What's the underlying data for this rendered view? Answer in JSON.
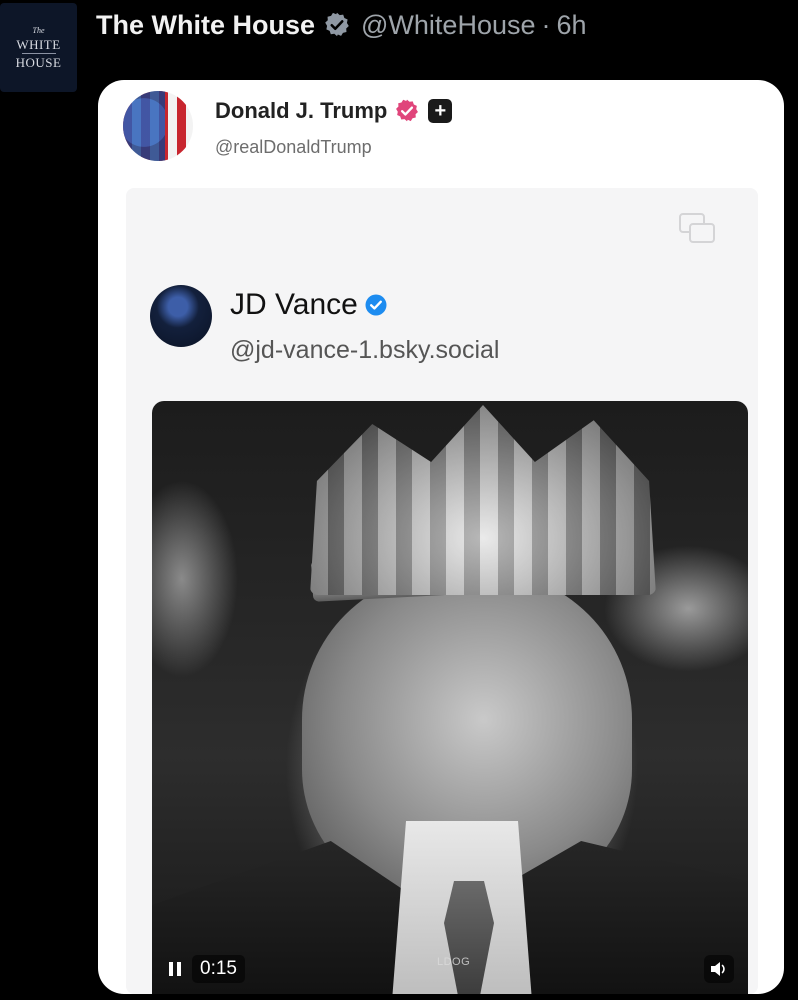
{
  "post": {
    "author_name": "The White House",
    "author_handle": "@WhiteHouse",
    "separator": "·",
    "time": "6h",
    "avatar_logo_the": "The",
    "avatar_logo_line1": "WHITE",
    "avatar_logo_line2": "HOUSE"
  },
  "quoted": {
    "author_name": "Donald J. Trump",
    "author_handle": "@realDonaldTrump",
    "plus_label": "+",
    "nested": {
      "author_name": "JD Vance",
      "author_handle": "@jd-vance-1.bsky.social",
      "video": {
        "time": "0:15",
        "watermark": "LDOG",
        "state": "playing"
      }
    }
  },
  "colors": {
    "background": "#000000",
    "card": "#ffffff",
    "verified_gray": "#8f98a3",
    "verified_pink": "#e0457b",
    "verified_blue": "#1d8cf0"
  },
  "icons": {
    "verified": "verified-badge-icon",
    "copy": "copy-icon",
    "pause": "pause-icon",
    "volume": "volume-icon"
  }
}
